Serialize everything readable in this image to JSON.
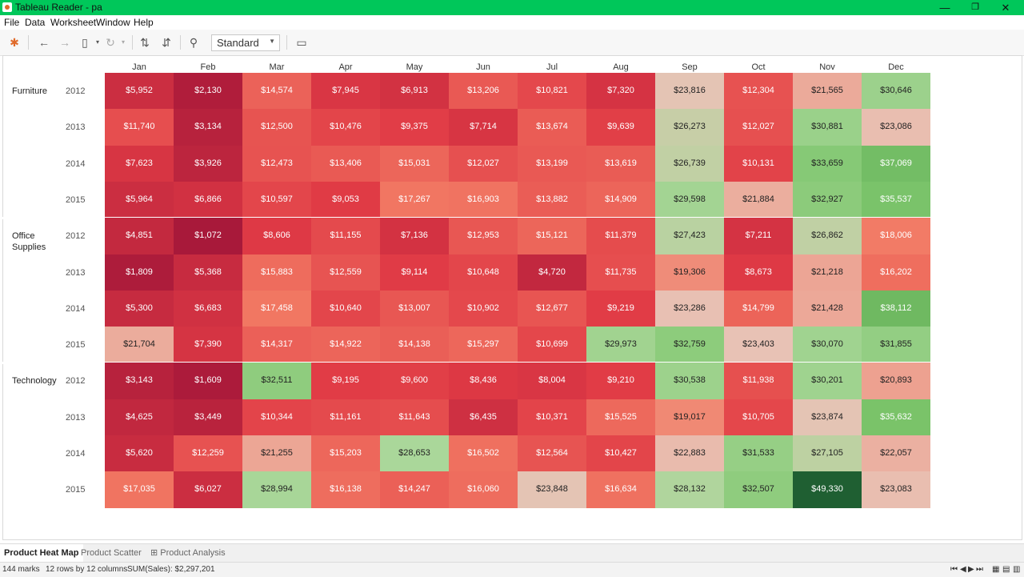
{
  "window": {
    "title": "Tableau Reader - pa",
    "minimize": "—",
    "maximize": "❐",
    "close": "✕"
  },
  "menu": [
    "File",
    "Data",
    "Worksheet",
    "Window",
    "Help"
  ],
  "toolbar": {
    "view_mode": "Standard",
    "icons": [
      "tableau-logo-icon",
      "undo-icon",
      "redo-icon",
      "save-icon",
      "refresh-icon",
      "sort-ascending-icon",
      "sort-descending-icon",
      "pin-icon",
      "presentation-icon"
    ]
  },
  "chart_data": {
    "type": "heatmap",
    "columns": [
      "Jan",
      "Feb",
      "Mar",
      "Apr",
      "May",
      "Jun",
      "Jul",
      "Aug",
      "Sep",
      "Oct",
      "Nov",
      "Dec"
    ],
    "groups": [
      {
        "category": "Furniture",
        "rows": [
          {
            "year": "2012",
            "values": [
              "$5,952",
              "$2,130",
              "$14,574",
              "$7,945",
              "$6,913",
              "$13,206",
              "$10,821",
              "$7,320",
              "$23,816",
              "$12,304",
              "$21,565",
              "$30,646"
            ]
          },
          {
            "year": "2013",
            "values": [
              "$11,740",
              "$3,134",
              "$12,500",
              "$10,476",
              "$9,375",
              "$7,714",
              "$13,674",
              "$9,639",
              "$26,273",
              "$12,027",
              "$30,881",
              "$23,086"
            ]
          },
          {
            "year": "2014",
            "values": [
              "$7,623",
              "$3,926",
              "$12,473",
              "$13,406",
              "$15,031",
              "$12,027",
              "$13,199",
              "$13,619",
              "$26,739",
              "$10,131",
              "$33,659",
              "$37,069"
            ]
          },
          {
            "year": "2015",
            "values": [
              "$5,964",
              "$6,866",
              "$10,597",
              "$9,053",
              "$17,267",
              "$16,903",
              "$13,882",
              "$14,909",
              "$29,598",
              "$21,884",
              "$32,927",
              "$35,537"
            ]
          }
        ]
      },
      {
        "category": "Office Supplies",
        "rows": [
          {
            "year": "2012",
            "values": [
              "$4,851",
              "$1,072",
              "$8,606",
              "$11,155",
              "$7,136",
              "$12,953",
              "$15,121",
              "$11,379",
              "$27,423",
              "$7,211",
              "$26,862",
              "$18,006"
            ]
          },
          {
            "year": "2013",
            "values": [
              "$1,809",
              "$5,368",
              "$15,883",
              "$12,559",
              "$9,114",
              "$10,648",
              "$4,720",
              "$11,735",
              "$19,306",
              "$8,673",
              "$21,218",
              "$16,202"
            ]
          },
          {
            "year": "2014",
            "values": [
              "$5,300",
              "$6,683",
              "$17,458",
              "$10,640",
              "$13,007",
              "$10,902",
              "$12,677",
              "$9,219",
              "$23,286",
              "$14,799",
              "$21,428",
              "$38,112"
            ]
          },
          {
            "year": "2015",
            "values": [
              "$21,704",
              "$7,390",
              "$14,317",
              "$14,922",
              "$14,138",
              "$15,297",
              "$10,699",
              "$29,973",
              "$32,759",
              "$23,403",
              "$30,070",
              "$31,855"
            ]
          }
        ]
      },
      {
        "category": "Technology",
        "rows": [
          {
            "year": "2012",
            "values": [
              "$3,143",
              "$1,609",
              "$32,511",
              "$9,195",
              "$9,600",
              "$8,436",
              "$8,004",
              "$9,210",
              "$30,538",
              "$11,938",
              "$30,201",
              "$20,893"
            ]
          },
          {
            "year": "2013",
            "values": [
              "$4,625",
              "$3,449",
              "$10,344",
              "$11,161",
              "$11,643",
              "$6,435",
              "$10,371",
              "$15,525",
              "$19,017",
              "$10,705",
              "$23,874",
              "$35,632"
            ]
          },
          {
            "year": "2014",
            "values": [
              "$5,620",
              "$12,259",
              "$21,255",
              "$15,203",
              "$28,653",
              "$16,502",
              "$12,564",
              "$10,427",
              "$22,883",
              "$31,533",
              "$27,105",
              "$22,057"
            ]
          },
          {
            "year": "2015",
            "values": [
              "$17,035",
              "$6,027",
              "$28,994",
              "$16,138",
              "$14,247",
              "$16,060",
              "$23,848",
              "$16,634",
              "$28,132",
              "$32,507",
              "$49,330",
              "$23,083"
            ]
          }
        ]
      }
    ],
    "color_scale": {
      "low": "#a8193a",
      "mid": "#e8c3b6",
      "high": "#1f5f32"
    }
  },
  "tabs": [
    "Product Heat Map",
    "Product Scatter",
    "⊞ Product Analysis"
  ],
  "status": {
    "marks": "144 marks",
    "dims": "12 rows by 12 columns",
    "sum": "SUM(Sales): $2,297,201"
  }
}
